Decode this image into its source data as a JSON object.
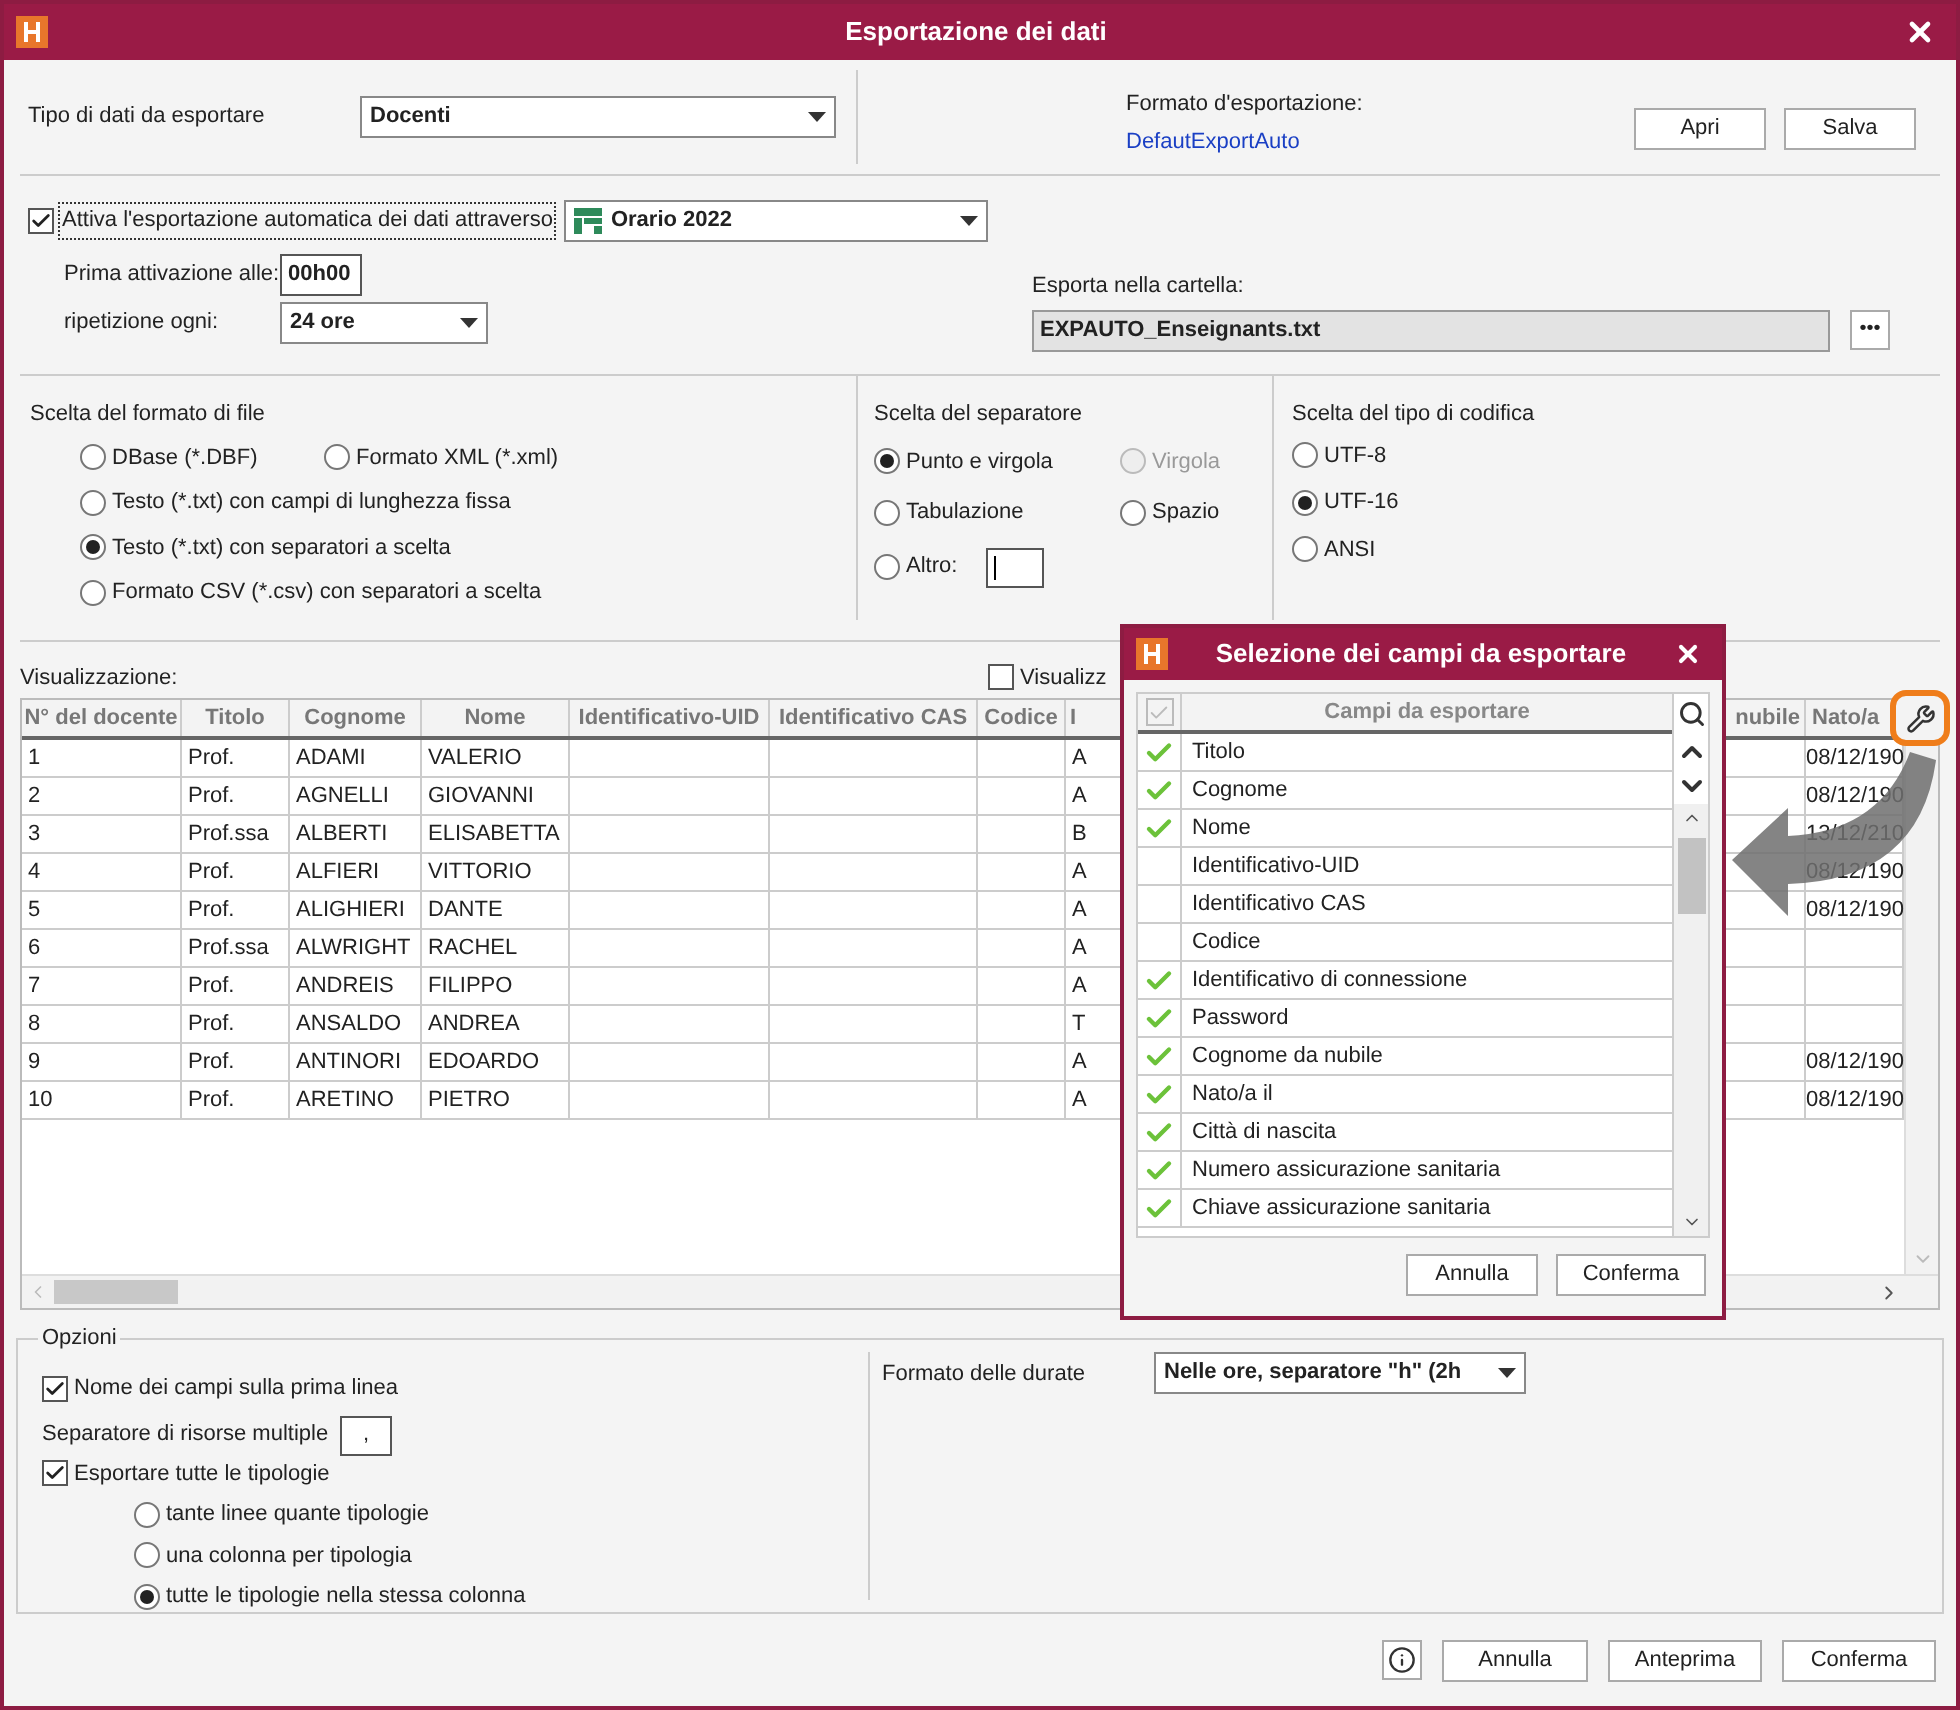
{
  "window": {
    "title": "Esportazione dei dati"
  },
  "export_type": {
    "label": "Tipo di dati da esportare",
    "value": "Docenti"
  },
  "export_format": {
    "label": "Formato d'esportazione:",
    "link": "DefautExportAuto",
    "buttons": [
      "Apri",
      "Salva"
    ]
  },
  "auto_export": {
    "label": "Attiva l'esportazione automatica dei dati attraverso",
    "checked": true,
    "source": "Orario 2022",
    "first_activation": {
      "label": "Prima attivazione alle:",
      "value": "00h00"
    },
    "repeat": {
      "label": "ripetizione ogni:",
      "value": "24 ore"
    },
    "folder": {
      "label": "Esporta nella cartella:",
      "value": "EXPAUTO_Enseignants.txt",
      "button": "•••"
    }
  },
  "file_format": {
    "title": "Scelta del formato di file",
    "options": [
      {
        "label": "DBase (*.DBF)",
        "selected": false
      },
      {
        "label": "Formato XML (*.xml)",
        "selected": false
      },
      {
        "label": "Testo (*.txt) con campi di lunghezza fissa",
        "selected": false
      },
      {
        "label": "Testo (*.txt) con separatori a scelta",
        "selected": true
      },
      {
        "label": "Formato CSV (*.csv) con separatori a scelta",
        "selected": false
      }
    ]
  },
  "separator": {
    "title": "Scelta del separatore",
    "options": [
      {
        "label": "Punto e virgola",
        "selected": true,
        "disabled": false
      },
      {
        "label": "Virgola",
        "selected": false,
        "disabled": true
      },
      {
        "label": "Tabulazione",
        "selected": false,
        "disabled": false
      },
      {
        "label": "Spazio",
        "selected": false,
        "disabled": false
      },
      {
        "label": "Altro:",
        "selected": false,
        "disabled": false
      }
    ]
  },
  "encoding": {
    "title": "Scelta del tipo di codifica",
    "options": [
      {
        "label": "UTF-8",
        "selected": false
      },
      {
        "label": "UTF-16",
        "selected": true
      },
      {
        "label": "ANSI",
        "selected": false
      }
    ]
  },
  "preview": {
    "label": "Visualizzazione:",
    "show_option": {
      "label": "Visualizz",
      "checked": false
    },
    "columns": [
      "N° del docente",
      "Titolo",
      "Cognome",
      "Nome",
      "Identificativo-UID",
      "Identificativo CAS",
      "Codice",
      "I",
      "nubile",
      "Nato/a"
    ],
    "rows": [
      [
        "1",
        "Prof.",
        "ADAMI",
        "VALERIO",
        null,
        null,
        null,
        "A",
        null,
        "08/12/190"
      ],
      [
        "2",
        "Prof.",
        "AGNELLI",
        "GIOVANNI",
        null,
        null,
        null,
        "A",
        null,
        "08/12/190"
      ],
      [
        "3",
        "Prof.ssa",
        "ALBERTI",
        "ELISABETTA",
        null,
        null,
        null,
        "B",
        null,
        "13/12/210"
      ],
      [
        "4",
        "Prof.",
        "ALFIERI",
        "VITTORIO",
        null,
        null,
        null,
        "A",
        null,
        "08/12/190"
      ],
      [
        "5",
        "Prof.",
        "ALIGHIERI",
        "DANTE",
        null,
        null,
        null,
        "A",
        null,
        "08/12/190"
      ],
      [
        "6",
        "Prof.ssa",
        "ALWRIGHT",
        "RACHEL",
        null,
        null,
        null,
        "A",
        null,
        null
      ],
      [
        "7",
        "Prof.",
        "ANDREIS",
        "FILIPPO",
        null,
        null,
        null,
        "A",
        null,
        null
      ],
      [
        "8",
        "Prof.",
        "ANSALDO",
        "ANDREA",
        null,
        null,
        null,
        "T",
        null,
        null
      ],
      [
        "9",
        "Prof.",
        "ANTINORI",
        "EDOARDO",
        null,
        null,
        null,
        "A",
        null,
        "08/12/190"
      ],
      [
        "10",
        "Prof.",
        "ARETINO",
        "PIETRO",
        null,
        null,
        null,
        "A",
        null,
        "08/12/190"
      ]
    ]
  },
  "options": {
    "title": "Opzioni",
    "field_names": {
      "label": "Nome dei campi sulla prima linea",
      "checked": true
    },
    "multi_separator": {
      "label": "Separatore di risorse multiple",
      "value": ","
    },
    "all_types": {
      "label": "Esportare tutte le tipologie",
      "checked": true
    },
    "type_modes": [
      {
        "label": "tante linee quante tipologie",
        "selected": false
      },
      {
        "label": "una colonna per tipologia",
        "selected": false
      },
      {
        "label": "tutte le tipologie nella stessa colonna",
        "selected": true
      }
    ],
    "duration": {
      "label": "Formato delle durate",
      "value": "Nelle ore, separatore \"h\" (2h"
    }
  },
  "footer_buttons": [
    "Annulla",
    "Anteprima",
    "Conferma"
  ],
  "field_dialog": {
    "title": "Selezione dei campi da esportare",
    "column": "Campi da esportare",
    "fields": [
      {
        "label": "Titolo",
        "checked": true
      },
      {
        "label": "Cognome",
        "checked": true
      },
      {
        "label": "Nome",
        "checked": true
      },
      {
        "label": "Identificativo-UID",
        "checked": false
      },
      {
        "label": "Identificativo CAS",
        "checked": false
      },
      {
        "label": "Codice",
        "checked": false
      },
      {
        "label": "Identificativo di connessione",
        "checked": true
      },
      {
        "label": "Password",
        "checked": true
      },
      {
        "label": "Cognome da nubile",
        "checked": true
      },
      {
        "label": "Nato/a il",
        "checked": true
      },
      {
        "label": "Città di nascita",
        "checked": true
      },
      {
        "label": "Numero assicurazione sanitaria",
        "checked": true
      },
      {
        "label": "Chiave assicurazione sanitaria",
        "checked": true
      }
    ],
    "buttons": [
      "Annulla",
      "Conferma"
    ]
  }
}
